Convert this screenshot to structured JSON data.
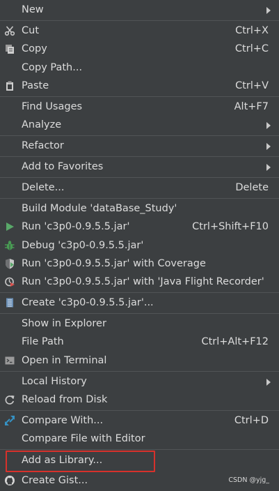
{
  "menu": {
    "new": {
      "label": "New"
    },
    "cut": {
      "label": "Cut",
      "shortcut": "Ctrl+X"
    },
    "copy": {
      "label": "Copy",
      "shortcut": "Ctrl+C"
    },
    "copy_path": {
      "label": "Copy Path..."
    },
    "paste": {
      "label": "Paste",
      "shortcut": "Ctrl+V"
    },
    "find_usages": {
      "label": "Find Usages",
      "shortcut": "Alt+F7"
    },
    "analyze": {
      "label": "Analyze"
    },
    "refactor": {
      "label": "Refactor"
    },
    "add_to_favorites": {
      "label": "Add to Favorites"
    },
    "delete": {
      "label": "Delete...",
      "shortcut": "Delete"
    },
    "build_module": {
      "label": "Build Module 'dataBase_Study'"
    },
    "run": {
      "label": "Run 'c3p0-0.9.5.5.jar'",
      "shortcut": "Ctrl+Shift+F10"
    },
    "debug": {
      "label": "Debug 'c3p0-0.9.5.5.jar'"
    },
    "run_coverage": {
      "label": "Run 'c3p0-0.9.5.5.jar' with Coverage"
    },
    "run_jfr": {
      "label": "Run 'c3p0-0.9.5.5.jar' with 'Java Flight Recorder'"
    },
    "create_config": {
      "label": "Create 'c3p0-0.9.5.5.jar'..."
    },
    "show_in_explorer": {
      "label": "Show in Explorer"
    },
    "file_path": {
      "label": "File Path",
      "shortcut": "Ctrl+Alt+F12"
    },
    "open_in_terminal": {
      "label": "Open in Terminal"
    },
    "local_history": {
      "label": "Local History"
    },
    "reload_from_disk": {
      "label": "Reload from Disk"
    },
    "compare_with": {
      "label": "Compare With...",
      "shortcut": "Ctrl+D"
    },
    "compare_file_editor": {
      "label": "Compare File with Editor"
    },
    "add_as_library": {
      "label": "Add as Library..."
    },
    "create_gist": {
      "label": "Create Gist..."
    }
  },
  "watermark": "CSDN @yjg_",
  "colors": {
    "background": "#3c3f41",
    "separator": "#515456",
    "text": "#dcdcdc",
    "highlight_box": "#d7312b",
    "run_green": "#59a869",
    "debug_green": "#499c54",
    "compare_blue": "#3592c4"
  },
  "icons": {
    "cut": "scissors-icon",
    "copy": "copy-icon",
    "paste": "clipboard-icon",
    "run": "play-icon",
    "debug": "bug-icon",
    "coverage": "shield-icon",
    "jfr": "flight-recorder-icon",
    "create": "configuration-icon",
    "terminal": "terminal-icon",
    "reload": "reload-icon",
    "compare": "compare-arrows-icon",
    "gist": "github-icon"
  }
}
